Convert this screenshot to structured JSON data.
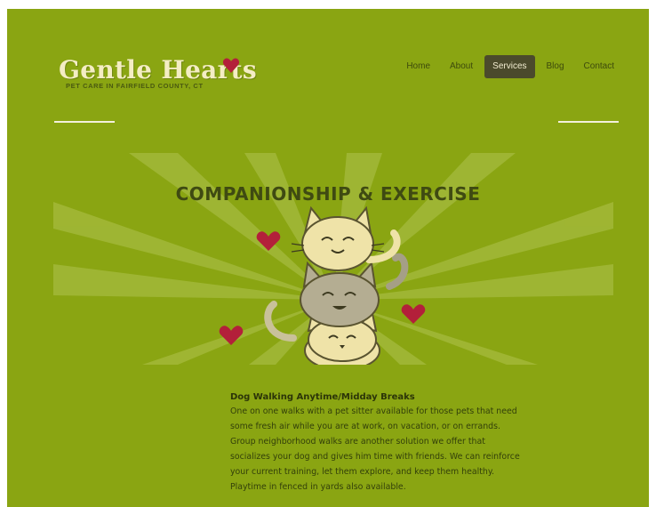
{
  "brand": {
    "title": "Gentle Hearts",
    "tagline": "PET CARE IN FAIRFIELD COUNTY, CT",
    "heart_color": "#b3203a"
  },
  "nav": {
    "items": [
      {
        "label": "Home",
        "active": false
      },
      {
        "label": "About",
        "active": false
      },
      {
        "label": "Services",
        "active": true
      },
      {
        "label": "Blog",
        "active": false
      },
      {
        "label": "Contact",
        "active": false
      }
    ]
  },
  "hero": {
    "title": "COMPANIONSHIP & EXERCISE",
    "illustration": "stacked-cats-icon",
    "heart_icon": "heart-icon"
  },
  "content": {
    "heading": "Dog Walking Anytime/Midday Breaks",
    "body": "One on one walks with a pet sitter available for those pets that need some fresh air while you are at work, on vacation, or on errands. Group neighborhood walks are another solution we offer that socializes your dog and gives him time with friends. We can reinforce your current training, let them explore, and keep them healthy. Playtime in fenced in yards also available."
  },
  "colors": {
    "page_bg": "#8aa512",
    "accent_dark": "#4b4a2c",
    "cream": "#f4edc4",
    "heart": "#b3203a"
  }
}
